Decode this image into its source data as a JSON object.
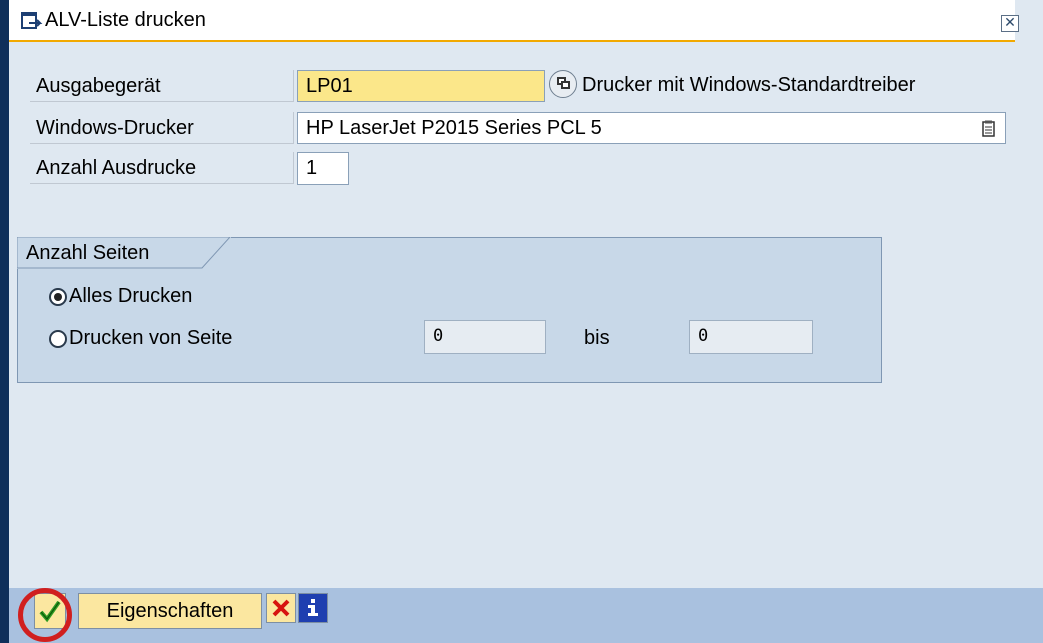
{
  "window": {
    "title": "ALV-Liste drucken",
    "close_glyph": "✕"
  },
  "form": {
    "output_device": {
      "label": "Ausgabegerät",
      "value": "LP01",
      "description": "Drucker mit Windows-Standardtreiber"
    },
    "windows_printer": {
      "label": "Windows-Drucker",
      "value": "HP LaserJet P2015 Series PCL 5"
    },
    "copies": {
      "label": "Anzahl Ausdrucke",
      "value": "1"
    }
  },
  "pages_group": {
    "title": "Anzahl Seiten",
    "option_all": {
      "label": "Alles Drucken",
      "selected": true
    },
    "option_range": {
      "label": "Drucken von Seite",
      "selected": false
    },
    "from_value": "0",
    "to_label": "bis",
    "to_value": "0"
  },
  "toolbar": {
    "properties_label": "Eigenschaften"
  },
  "icons": {
    "title": "dialog-icon",
    "match": "value-help-icon",
    "dropdown": "list-icon",
    "ok": "checkmark-icon",
    "cancel": "cancel-x-icon",
    "info": "info-icon"
  },
  "colors": {
    "background": "#dfe8f1",
    "title_underline": "#f2a900",
    "required_field": "#fbe78a",
    "group_bg": "#c8d8e8",
    "toolbar": "#a9c1df",
    "highlight_circle": "#d01f1f"
  }
}
